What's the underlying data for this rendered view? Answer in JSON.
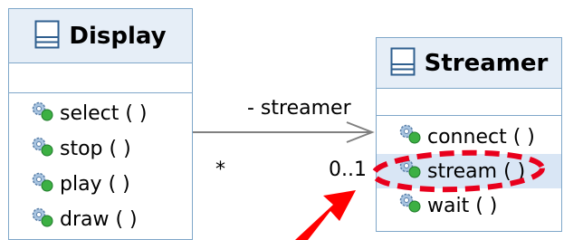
{
  "classes": {
    "display": {
      "name": "Display",
      "operations": [
        "select ( )",
        "stop ( )",
        "play ( )",
        "draw ( )"
      ]
    },
    "streamer": {
      "name": "Streamer",
      "operations": [
        "connect ( )",
        "stream ( )",
        "wait ( )"
      ]
    }
  },
  "association": {
    "role": "- streamer",
    "source_multiplicity": "*",
    "target_multiplicity": "0..1"
  },
  "highlight": {
    "operation": "stream ( )",
    "color": "#e8001c"
  },
  "colors": {
    "border": "#7fa7c9",
    "header_bg": "#e6eef7",
    "arrow_red": "#ff0000"
  }
}
